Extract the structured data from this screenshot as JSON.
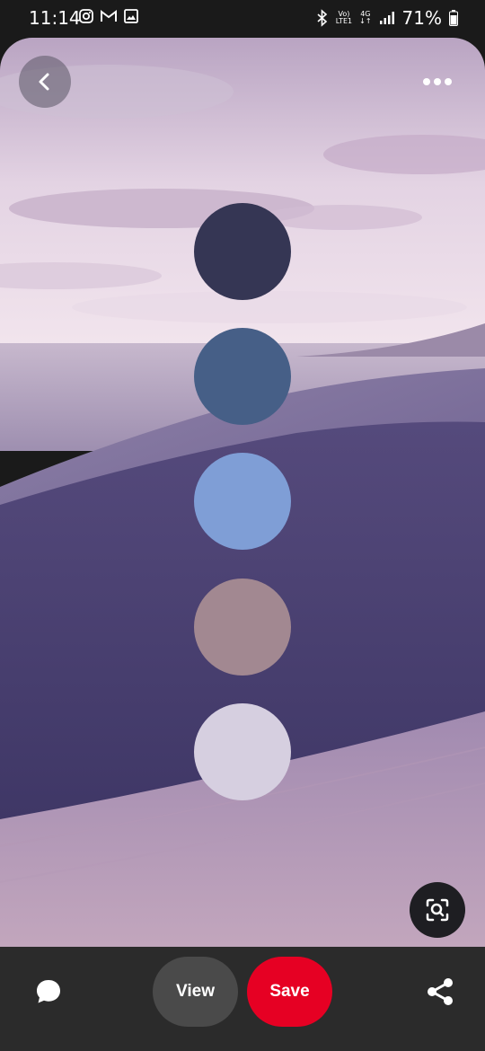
{
  "status_bar": {
    "time": "11:14",
    "left_icons": [
      "instagram-icon",
      "gmail-icon",
      "gallery-icon"
    ],
    "right_icons": [
      "bluetooth-icon",
      "volte-icon",
      "4g-icon",
      "signal-icon",
      "battery-icon"
    ],
    "volte_top": "Vo)",
    "volte_bottom": "LTE1",
    "network_top": "4G",
    "network_bottom": "↓↑",
    "battery": "71%"
  },
  "pin": {
    "swatches": [
      {
        "color": "#353654"
      },
      {
        "color": "#465f87"
      },
      {
        "color": "#7f9ed6"
      },
      {
        "color": "#a28891"
      },
      {
        "color": "#d6cfe0"
      }
    ]
  },
  "actions": {
    "back_icon": "chevron-left-icon",
    "more_icon": "more-horizontal-icon",
    "visual_search_icon": "visual-search-icon",
    "comment_icon": "comment-icon",
    "share_icon": "share-icon",
    "view_label": "View",
    "save_label": "Save",
    "save_color": "#e60023"
  }
}
